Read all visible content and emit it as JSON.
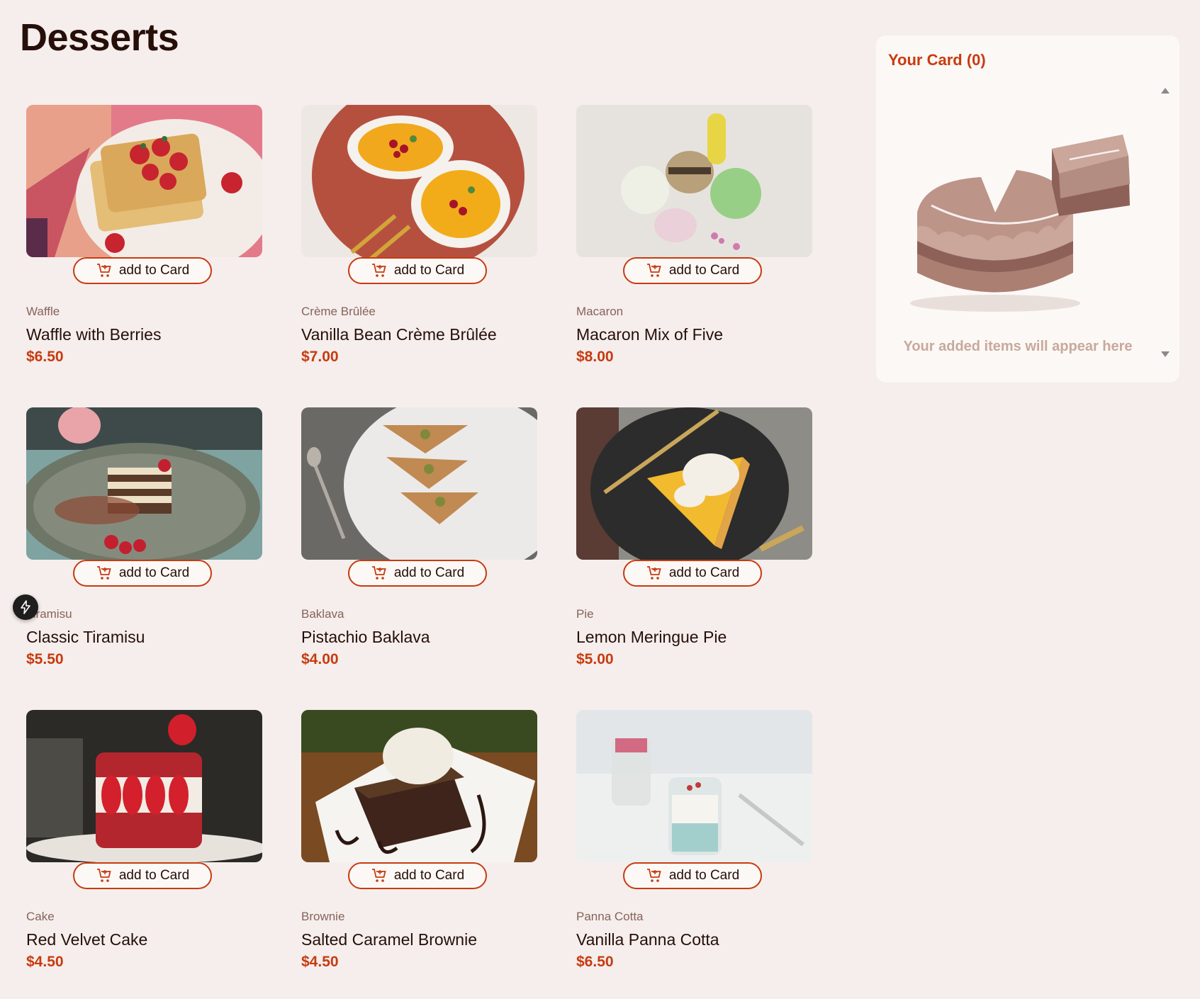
{
  "page": {
    "title": "Desserts"
  },
  "products": [
    {
      "category": "Waffle",
      "name": "Waffle with Berries",
      "price": "$6.50",
      "button": "add to Card",
      "image": "waffle-photo"
    },
    {
      "category": "Crème Brûlée",
      "name": "Vanilla Bean Crème Brûlée",
      "price": "$7.00",
      "button": "add to Card",
      "image": "creme-brulee-photo"
    },
    {
      "category": "Macaron",
      "name": "Macaron Mix of Five",
      "price": "$8.00",
      "button": "add to Card",
      "image": "macaron-photo"
    },
    {
      "category": "Tiramisu",
      "name": "Classic Tiramisu",
      "price": "$5.50",
      "button": "add to Card",
      "image": "tiramisu-photo"
    },
    {
      "category": "Baklava",
      "name": "Pistachio Baklava",
      "price": "$4.00",
      "button": "add to Card",
      "image": "baklava-photo"
    },
    {
      "category": "Pie",
      "name": "Lemon Meringue Pie",
      "price": "$5.00",
      "button": "add to Card",
      "image": "pie-photo"
    },
    {
      "category": "Cake",
      "name": "Red Velvet Cake",
      "price": "$4.50",
      "button": "add to Card",
      "image": "cake-photo"
    },
    {
      "category": "Brownie",
      "name": "Salted Caramel Brownie",
      "price": "$4.50",
      "button": "add to Card",
      "image": "brownie-photo"
    },
    {
      "category": "Panna Cotta",
      "name": "Vanilla Panna Cotta",
      "price": "$6.50",
      "button": "add to Card",
      "image": "panna-cotta-photo"
    }
  ],
  "cart": {
    "title": "Your Card (0)",
    "empty_message": "Your added items will appear here",
    "illustration": "empty-cake-illustration"
  },
  "colors": {
    "accent": "#c73b0f",
    "background": "#f5eeec",
    "text": "#260f08",
    "muted": "#87635a"
  },
  "icons": {
    "cart": "add-to-cart-icon",
    "devtools": "lightning-icon"
  }
}
